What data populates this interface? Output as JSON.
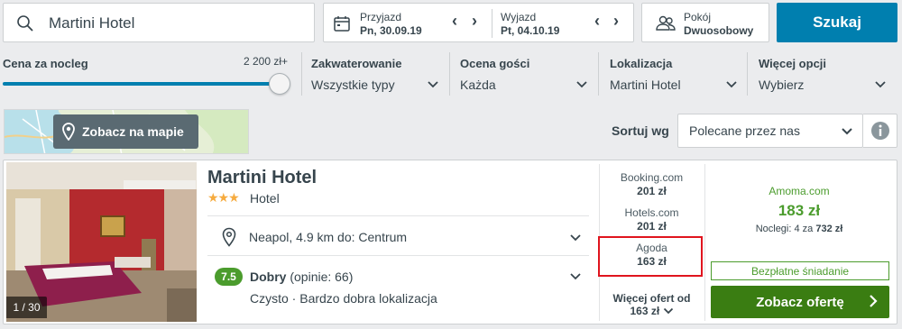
{
  "search": {
    "destination": "Martini Hotel"
  },
  "dates": {
    "checkin_label": "Przyjazd",
    "checkin_value": "Pn, 30.09.19",
    "checkout_label": "Wyjazd",
    "checkout_value": "Pt, 04.10.19"
  },
  "rooms": {
    "label": "Pokój",
    "value": "Dwuosobowy"
  },
  "search_button": "Szukaj",
  "filters": {
    "price_label": "Cena za nocleg",
    "price_max": "2 200 zł+",
    "price_level": 1.0,
    "accommodation_label": "Zakwaterowanie",
    "accommodation_value": "Wszystkie typy",
    "rating_label": "Ocena gości",
    "rating_value": "Każda",
    "location_label": "Lokalizacja",
    "location_value": "Martini Hotel",
    "more_label": "Więcej opcji",
    "more_value": "Wybierz"
  },
  "map": {
    "button_label": "Zobacz na mapie"
  },
  "sort": {
    "label": "Sortuj wg",
    "value": "Polecane przez nas"
  },
  "hotel": {
    "name": "Martini Hotel",
    "stars": "★★★",
    "type": "Hotel",
    "photo_counter": "1 / 30",
    "location": "Neapol, 4.9 km do: Centrum",
    "rating_score": "7.5",
    "rating_word": "Dobry",
    "rating_reviews": "(opinie: 66)",
    "rating_sub": "Czysto · Bardzo dobra lokalizacja",
    "offers": [
      {
        "site": "Booking.com",
        "price": "201 zł"
      },
      {
        "site": "Hotels.com",
        "price": "201 zł"
      },
      {
        "site": "Agoda",
        "price": "163 zł"
      }
    ],
    "more_offers_label": "Więcej ofert od",
    "more_offers_price": "163 zł",
    "best": {
      "site": "Amoma.com",
      "price": "183 zł",
      "nights_text": "Noclegi: 4 za",
      "nights_total": "732 zł",
      "breakfast": "Bezpłatne śniadanie",
      "cta": "Zobacz ofertę"
    }
  },
  "colors": {
    "primary": "#007faf",
    "deal_green": "#3a7d12",
    "rating_green": "#4b9c2d",
    "highlight_red": "#e0141e",
    "star_orange": "#f6ab3f"
  }
}
